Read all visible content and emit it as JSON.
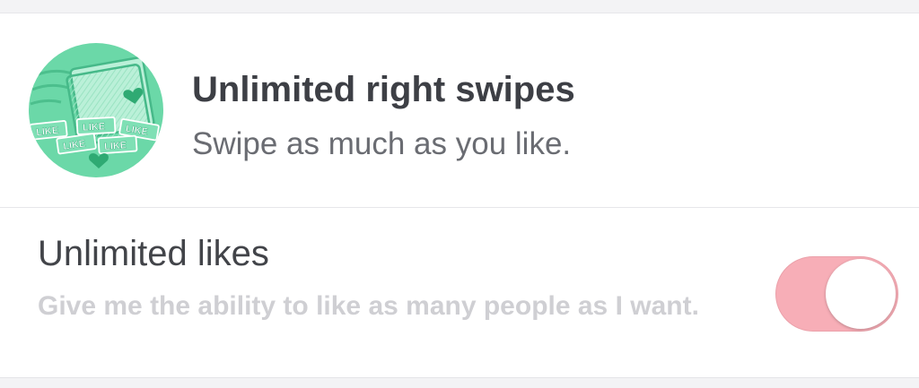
{
  "feature": {
    "icon": "like-cards-illustration",
    "title": "Unlimited right swipes",
    "subtitle": "Swipe as much as you like.",
    "card_labels": [
      "LIKE",
      "LIKE",
      "LIKE",
      "LIKE",
      "LIKE"
    ],
    "accent_color": "#5fd3a3"
  },
  "setting": {
    "title": "Unlimited likes",
    "description": "Give me the ability to like as many people as I want.",
    "toggle_on": true,
    "toggle_color": "#f7aeb7"
  }
}
